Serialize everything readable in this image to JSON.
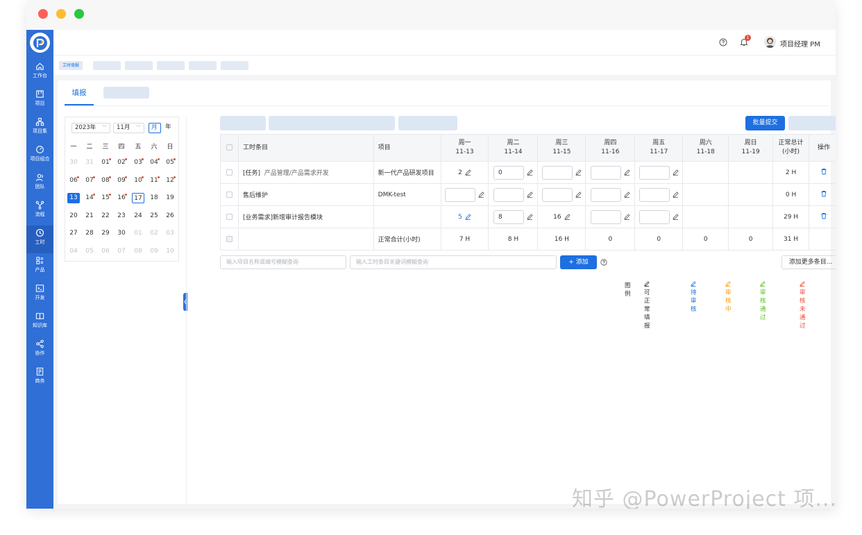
{
  "window": {
    "controls": {
      "close": "#ff5f57",
      "minimize": "#febc2e",
      "maximize": "#28c840"
    }
  },
  "theme": {
    "accent": "#1e6fe0",
    "sidebar": "#2f6fd6",
    "status_danger": "#e74c3c"
  },
  "sidebar": {
    "logo_icon": "powerproject-logo-icon",
    "items": [
      {
        "label": "工作台",
        "icon": "home-icon"
      },
      {
        "label": "项目",
        "icon": "project-board-icon"
      },
      {
        "label": "项目集",
        "icon": "project-set-icon"
      },
      {
        "label": "项目组合",
        "icon": "dashboard-gauge-icon"
      },
      {
        "label": "团队",
        "icon": "team-icon"
      },
      {
        "label": "流程",
        "icon": "flow-icon"
      },
      {
        "label": "工时",
        "icon": "clock-icon"
      },
      {
        "label": "产品",
        "icon": "product-icon"
      },
      {
        "label": "开发",
        "icon": "terminal-icon"
      },
      {
        "label": "知识库",
        "icon": "book-icon"
      },
      {
        "label": "协作",
        "icon": "share-icon"
      },
      {
        "label": "商务",
        "icon": "contract-icon"
      }
    ],
    "active_index": 6
  },
  "header": {
    "user_name": "项目经理 PM",
    "notification_count": "1"
  },
  "breadcrumb": {
    "current": "工时填报"
  },
  "tabs": {
    "active": "填报"
  },
  "calendar": {
    "year": "2023年",
    "month": "11月",
    "view_month": "月",
    "view_year": "年",
    "weekdays": [
      "一",
      "二",
      "三",
      "四",
      "五",
      "六",
      "日"
    ],
    "weeks": [
      [
        "30",
        "31",
        "01",
        "02",
        "03",
        "04",
        "05"
      ],
      [
        "06",
        "07",
        "08",
        "09",
        "10",
        "11",
        "12"
      ],
      [
        "13",
        "14",
        "15",
        "16",
        "17",
        "18",
        "19"
      ],
      [
        "20",
        "21",
        "22",
        "23",
        "24",
        "25",
        "26"
      ],
      [
        "27",
        "28",
        "29",
        "30",
        "01",
        "02",
        "03"
      ],
      [
        "04",
        "05",
        "06",
        "07",
        "08",
        "09",
        "10"
      ]
    ]
  },
  "toolbar": {
    "batch_submit": "批量提交"
  },
  "table": {
    "headers": {
      "item": "工时条目",
      "project": "项目",
      "days": [
        {
          "day": "周一",
          "date": "11-13"
        },
        {
          "day": "周二",
          "date": "11-14"
        },
        {
          "day": "周三",
          "date": "11-15"
        },
        {
          "day": "周四",
          "date": "11-16"
        },
        {
          "day": "周五",
          "date": "11-17"
        },
        {
          "day": "周六",
          "date": "11-18"
        },
        {
          "day": "周日",
          "date": "11-19"
        }
      ],
      "total_line1": "正常总计",
      "total_line2": "(小时)",
      "action": "操作"
    },
    "rows": [
      {
        "item_prefix": "[任务]",
        "item_name": "产品管理/产品需求开发",
        "project": "新一代产品研发项目",
        "mon": "2",
        "tue": "0",
        "total": "2 H"
      },
      {
        "item_name": "售后维护",
        "project": "DMK-test",
        "total": "0 H"
      },
      {
        "item_name": "[业务需求]新增审计报告模块",
        "project": "",
        "mon": "5",
        "tue": "8",
        "wed": "16",
        "total": "29 H"
      }
    ],
    "summary": {
      "label": "正常合计(小时)",
      "values": [
        "7 H",
        "8 H",
        "16 H",
        "0",
        "0",
        "0",
        "0"
      ],
      "total": "31 H"
    }
  },
  "search": {
    "project_placeholder": "输入项目名称或编号模糊查询",
    "item_placeholder": "输入工时条目关键词模糊查询",
    "add_button": "+ 添加",
    "more_button": "添加更多条目..."
  },
  "legend": {
    "title": "图例",
    "items": [
      {
        "label": "可正常填报",
        "color": "#333333"
      },
      {
        "label": "待审核",
        "color": "#1e6fe0"
      },
      {
        "label": "审核中",
        "color": "#f39c12"
      },
      {
        "label": "审核通过",
        "color": "#52c41a"
      },
      {
        "label": "审核未通过",
        "color": "#e74c3c"
      }
    ]
  },
  "watermark": "知乎 @PowerProject 项..."
}
